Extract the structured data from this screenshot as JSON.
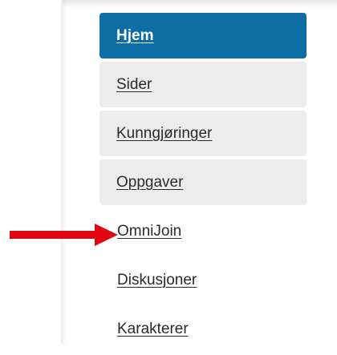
{
  "navigation": {
    "items": [
      {
        "label": "Hjem",
        "state": "active"
      },
      {
        "label": "Sider",
        "state": "highlighted"
      },
      {
        "label": "Kunngjøringer",
        "state": "highlighted"
      },
      {
        "label": "Oppgaver",
        "state": "highlighted"
      },
      {
        "label": "OmniJoin",
        "state": "plain"
      },
      {
        "label": "Diskusjoner",
        "state": "plain"
      },
      {
        "label": "Karakterer",
        "state": "plain"
      }
    ]
  },
  "annotation": {
    "arrow_target": "OmniJoin",
    "arrow_color": "#e20613"
  },
  "colors": {
    "active_bg": "#0c6ea4",
    "highlighted_bg": "#ececec",
    "link_text": "#2a2a2a",
    "active_text": "#ffffff"
  }
}
